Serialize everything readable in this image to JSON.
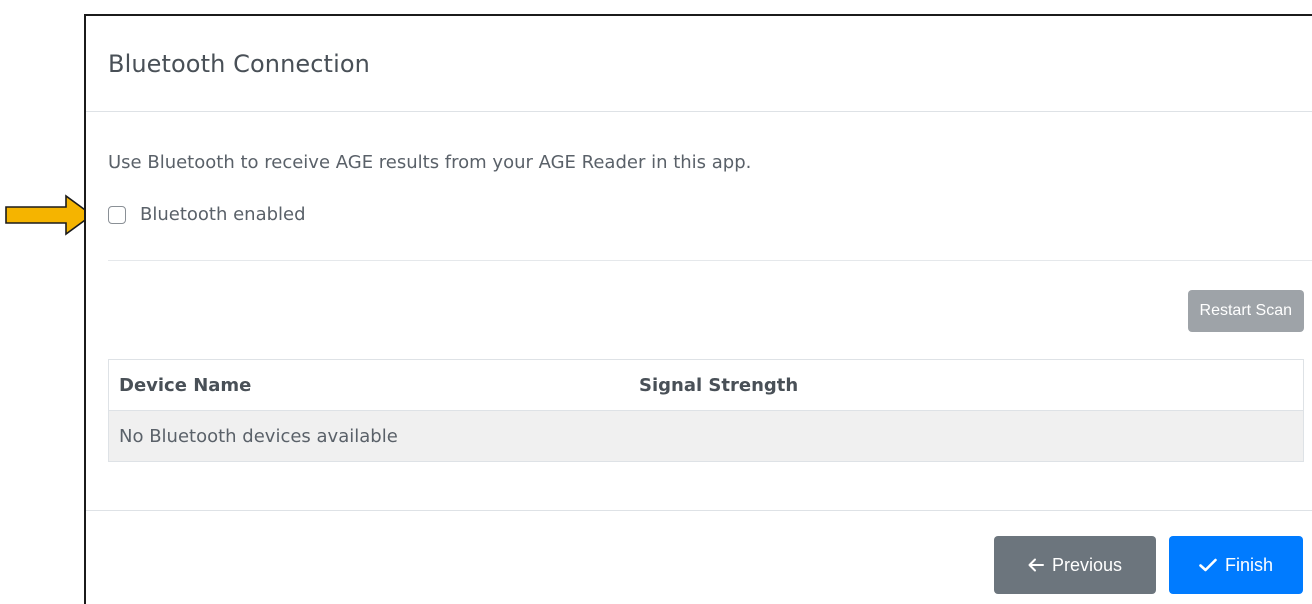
{
  "dialog": {
    "title": "Bluetooth Connection",
    "intro_text": "Use Bluetooth to receive AGE results from your AGE Reader in this app.",
    "bluetooth_checkbox": {
      "label": "Bluetooth enabled",
      "checked": false
    },
    "restart_scan_label": "Restart Scan",
    "table": {
      "columns": [
        "Device Name",
        "Signal Strength"
      ],
      "empty_message": "No Bluetooth devices available"
    },
    "footer": {
      "previous_label": "Previous",
      "finish_label": "Finish"
    }
  },
  "annotation": {
    "arrow_color": "#f5b400",
    "icon": "arrow-right-icon"
  },
  "colors": {
    "primary": "#007bff",
    "secondary": "#6c757d",
    "disabled": "#9ea3a8"
  }
}
